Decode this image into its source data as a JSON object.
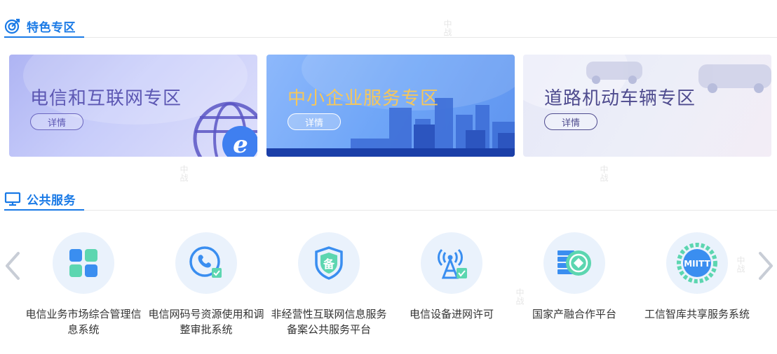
{
  "featured": {
    "title": "特色专区",
    "banners": [
      {
        "title": "电信和互联网专区",
        "button": "详情"
      },
      {
        "title": "中小企业服务专区",
        "button": "详情"
      },
      {
        "title": "道路机动车辆专区",
        "button": "详情"
      }
    ]
  },
  "public": {
    "title": "公共服务",
    "services": [
      {
        "name": "电信业务市场综合管理信息系统",
        "icon": "grid-apps-icon"
      },
      {
        "name": "电信网码号资源使用和调整审批系统",
        "icon": "phone-icon"
      },
      {
        "name": "非经营性互联网信息服务备案公共服务平台",
        "icon": "shield-filing-icon",
        "icon_text": "备"
      },
      {
        "name": "电信设备进网许可",
        "icon": "antenna-tower-icon"
      },
      {
        "name": "国家产融合作平台",
        "icon": "coin-stack-icon"
      },
      {
        "name": "工信智库共享服务系统",
        "icon": "miitt-gear-icon",
        "icon_text": "MIITT"
      }
    ]
  },
  "watermark": "中战",
  "colors": {
    "accent": "#1a7ae6",
    "service_circle": "#eaf2fc"
  }
}
